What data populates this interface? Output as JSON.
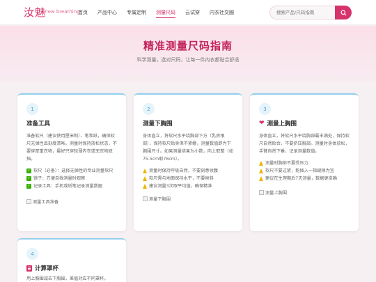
{
  "header": {
    "brand": "汝魅",
    "brand_sub": "View breathing",
    "nav": [
      "首页",
      "产品中心",
      "专属定制",
      "测量尺码",
      "云试穿",
      "内衣社交圈"
    ],
    "active_nav": "测量尺码",
    "search_placeholder": "搜索产品/尺码指南"
  },
  "hero": {
    "title": "精准测量尺码指南",
    "subtitle": "科学测量，选对尺码，让每一件内衣都贴合舒适"
  },
  "cards": [
    {
      "num": "1",
      "title": "准备工具",
      "desc": "准备软尺（建议使用厘米制）、笔和纸，确保软尺无弹性且刻度清晰。测量时保持放松状态，不要穿厚重衣物，最好只穿轻薄内衣或无衣物遮挡。",
      "tips": [
        "软尺（必备）：选择无弹性的专业测量软尺",
        "镜子：方便自我测量时观察",
        "记录工具：手机或纸笔记录测量数据"
      ],
      "image_alt": "测量工具准备"
    },
    {
      "num": "2",
      "title": "测量下胸围",
      "desc": "身体直立，将软尺水平绕胸部下方（乳房根部），保持软尺贴身但不紧绷，测量数值即为下胸围尺寸。如果测量结果为小数，向上取整（如75.5cm取76cm）。",
      "tips": [
        "测量时保持呼吸自然，不要刻意收腹",
        "软尺需与地面保持水平，不要倾斜",
        "建议测量3次取平均值，确保精准"
      ],
      "image_alt": "测量下胸围"
    },
    {
      "num": "3",
      "title": "测量上胸围",
      "desc": "身体直立，将软尺水平绕胸部最丰满处，保持软尺自然贴合，不要挤压胸部。测量时身体放松，手臂自然下垂，记录测量数值。",
      "tips": [
        "测量时胸部不要受压力",
        "软尺不要过紧，能插入一指缝隙为宜",
        "建议在生理期后7天测量，数据更准确"
      ],
      "image_alt": "测量上胸围"
    },
    {
      "num": "4",
      "title": "计算罩杯",
      "desc": "用上胸围减去下胸围，差值对应不同罩杯。"
    }
  ],
  "colors": {
    "accent": "#d6336c",
    "step": "#4aa2cf"
  }
}
